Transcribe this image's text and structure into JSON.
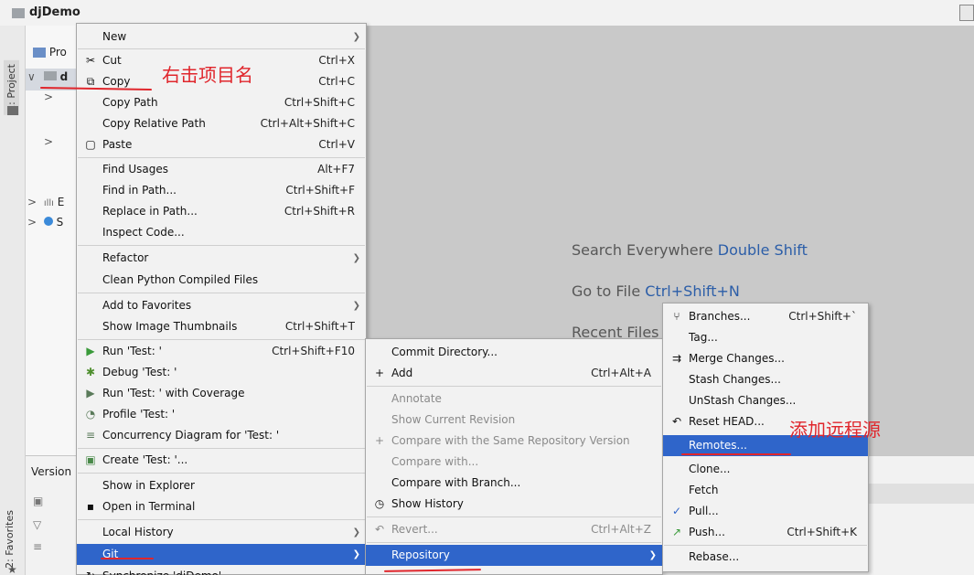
{
  "window": {
    "title": "djDemo"
  },
  "left_strip": {
    "project_tab": "1: Project",
    "favorites_tab": "2: Favorites"
  },
  "project_tree": {
    "header_label": "Pro",
    "rows": [
      {
        "arrow": "∨",
        "label": "d"
      },
      {
        "arrow": ">",
        "label": ""
      },
      {
        "arrow": ">",
        "label": ""
      },
      {
        "arrow": ">",
        "label": "E"
      },
      {
        "arrow": ">",
        "label": "S"
      }
    ]
  },
  "editor_hints": {
    "search": {
      "label": "Search Everywhere ",
      "key": "Double Shift"
    },
    "goto": {
      "label": "Go to File ",
      "key": "Ctrl+Shift+N"
    },
    "recent": {
      "label": "Recent Files"
    }
  },
  "version_panel": {
    "label": "Version"
  },
  "context_menu": {
    "items": [
      {
        "label": "New",
        "shortcut": "",
        "submenu": true,
        "icon": ""
      },
      {
        "label": "Cut",
        "shortcut": "Ctrl+X",
        "icon": "✂"
      },
      {
        "label": "Copy",
        "shortcut": "Ctrl+C",
        "icon": "⧉"
      },
      {
        "label": "Copy Path",
        "shortcut": "Ctrl+Shift+C",
        "icon": ""
      },
      {
        "label": "Copy Relative Path",
        "shortcut": "Ctrl+Alt+Shift+C",
        "icon": ""
      },
      {
        "label": "Paste",
        "shortcut": "Ctrl+V",
        "icon": "▢"
      },
      {
        "label": "Find Usages",
        "shortcut": "Alt+F7",
        "icon": ""
      },
      {
        "label": "Find in Path...",
        "shortcut": "Ctrl+Shift+F",
        "icon": ""
      },
      {
        "label": "Replace in Path...",
        "shortcut": "Ctrl+Shift+R",
        "icon": ""
      },
      {
        "label": "Inspect Code...",
        "shortcut": "",
        "icon": ""
      },
      {
        "label": "Refactor",
        "shortcut": "",
        "submenu": true,
        "icon": ""
      },
      {
        "label": "Clean Python Compiled Files",
        "shortcut": "",
        "icon": ""
      },
      {
        "label": "Add to Favorites",
        "shortcut": "",
        "submenu": true,
        "icon": ""
      },
      {
        "label": "Show Image Thumbnails",
        "shortcut": "Ctrl+Shift+T",
        "icon": ""
      },
      {
        "label": "Run 'Test: '",
        "shortcut": "Ctrl+Shift+F10",
        "icon": "▶"
      },
      {
        "label": "Debug 'Test: '",
        "shortcut": "",
        "icon": "✱"
      },
      {
        "label": "Run 'Test: ' with Coverage",
        "shortcut": "",
        "icon": "▶"
      },
      {
        "label": "Profile 'Test: '",
        "shortcut": "",
        "icon": "◔"
      },
      {
        "label": "Concurrency Diagram for 'Test: '",
        "shortcut": "",
        "icon": "≡"
      },
      {
        "label": "Create 'Test: '...",
        "shortcut": "",
        "icon": "▣"
      },
      {
        "label": "Show in Explorer",
        "shortcut": "",
        "icon": ""
      },
      {
        "label": "Open in Terminal",
        "shortcut": "",
        "icon": "▪"
      },
      {
        "label": "Local History",
        "shortcut": "",
        "submenu": true,
        "icon": ""
      },
      {
        "label": "Git",
        "shortcut": "",
        "submenu": true,
        "icon": ""
      },
      {
        "label": "Synchronize 'djDemo'",
        "shortcut": "",
        "icon": "↻"
      }
    ]
  },
  "git_menu": {
    "items": [
      {
        "label": "Commit Directory...",
        "shortcut": "",
        "icon": ""
      },
      {
        "label": "Add",
        "shortcut": "Ctrl+Alt+A",
        "icon": "+"
      },
      {
        "label": "Annotate",
        "shortcut": "",
        "icon": ""
      },
      {
        "label": "Show Current Revision",
        "shortcut": "",
        "icon": ""
      },
      {
        "label": "Compare with the Same Repository Version",
        "shortcut": "",
        "icon": "+"
      },
      {
        "label": "Compare with...",
        "shortcut": "",
        "icon": ""
      },
      {
        "label": "Compare with Branch...",
        "shortcut": "",
        "icon": ""
      },
      {
        "label": "Show History",
        "shortcut": "",
        "icon": "◷"
      },
      {
        "label": "Revert...",
        "shortcut": "Ctrl+Alt+Z",
        "icon": "↶"
      },
      {
        "label": "Repository",
        "shortcut": "",
        "submenu": true,
        "icon": ""
      }
    ]
  },
  "repo_menu": {
    "items": [
      {
        "label": "Branches...",
        "shortcut": "Ctrl+Shift+`",
        "icon": "⑂"
      },
      {
        "label": "Tag...",
        "shortcut": "",
        "icon": ""
      },
      {
        "label": "Merge Changes...",
        "shortcut": "",
        "icon": "⇉"
      },
      {
        "label": "Stash Changes...",
        "shortcut": "",
        "icon": ""
      },
      {
        "label": "UnStash Changes...",
        "shortcut": "",
        "icon": ""
      },
      {
        "label": "Reset HEAD...",
        "shortcut": "",
        "icon": "↶"
      },
      {
        "label": "Remotes...",
        "shortcut": "",
        "icon": ""
      },
      {
        "label": "Clone...",
        "shortcut": "",
        "icon": ""
      },
      {
        "label": "Fetch",
        "shortcut": "",
        "icon": ""
      },
      {
        "label": "Pull...",
        "shortcut": "",
        "icon": "✓"
      },
      {
        "label": "Push...",
        "shortcut": "Ctrl+Shift+K",
        "icon": "↗"
      },
      {
        "label": "Rebase...",
        "shortcut": "",
        "icon": ""
      }
    ]
  },
  "annotations": {
    "right_click_project": "右击项目名",
    "add_remote_source": "添加远程源"
  },
  "colors": {
    "selection": "#2f65ca",
    "annotation": "#e0262c",
    "editor_bg": "#c9c9c9"
  }
}
